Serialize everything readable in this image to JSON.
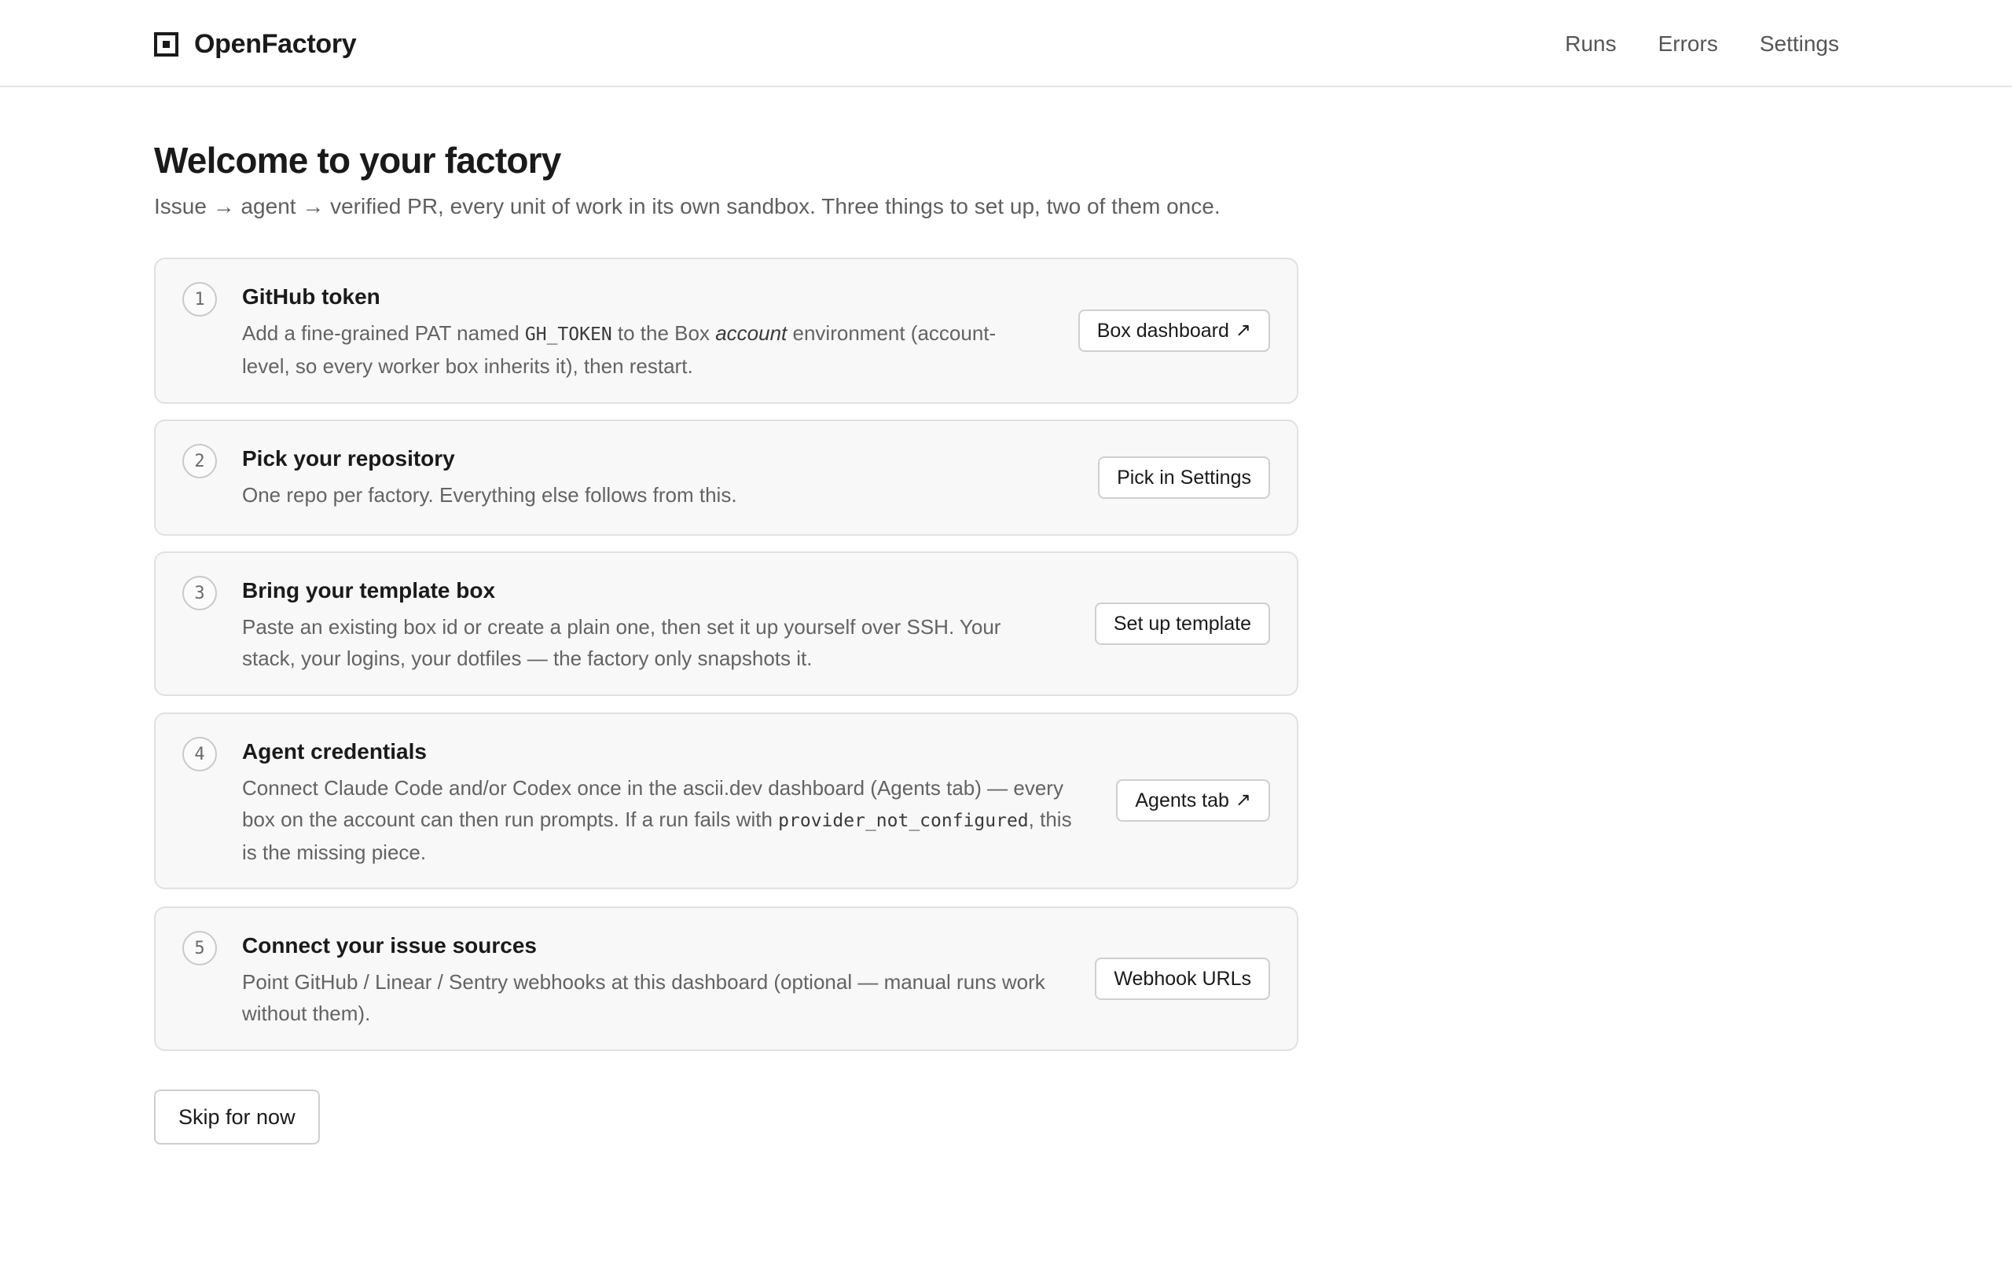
{
  "app": {
    "name": "OpenFactory",
    "logo_icon": "square-logo-icon"
  },
  "nav": {
    "items": [
      "Runs",
      "Errors",
      "Settings"
    ]
  },
  "page": {
    "title": "Welcome to your factory",
    "intro": "Issue → agent → verified PR, every unit of work in its own sandbox. Three things to set up, two of them once."
  },
  "steps": [
    {
      "number": "1",
      "title": "GitHub token",
      "desc_parts": {
        "a": "Add a fine-grained PAT named ",
        "code": "GH_TOKEN",
        "b": " to the Box ",
        "em": "account",
        "c": " environment (account-level, so every worker box inherits it), then restart."
      },
      "button": "Box dashboard",
      "button_icon": "external-link-arrow-icon"
    },
    {
      "number": "2",
      "title": "Pick your repository",
      "desc": "One repo per factory. Everything else follows from this.",
      "button": "Pick in Settings"
    },
    {
      "number": "3",
      "title": "Bring your template box",
      "desc": "Paste an existing box id or create a plain one, then set it up yourself over SSH. Your stack, your logins, your dotfiles — the factory only snapshots it.",
      "button": "Set up template"
    },
    {
      "number": "4",
      "title": "Agent credentials",
      "desc_parts": {
        "a": "Connect Claude Code and/or Codex once in the ascii.dev dashboard (Agents tab) — every box on the account can then run prompts. If a run fails with ",
        "code": "provider_not_configured",
        "b": ", this is the missing piece."
      },
      "button": "Agents tab",
      "button_icon": "external-link-arrow-icon"
    },
    {
      "number": "5",
      "title": "Connect your issue sources",
      "desc": "Point GitHub / Linear / Sentry webhooks at this dashboard (optional — manual runs work without them).",
      "button": "Webhook URLs"
    }
  ],
  "footer": {
    "skip_label": "Skip for now"
  }
}
